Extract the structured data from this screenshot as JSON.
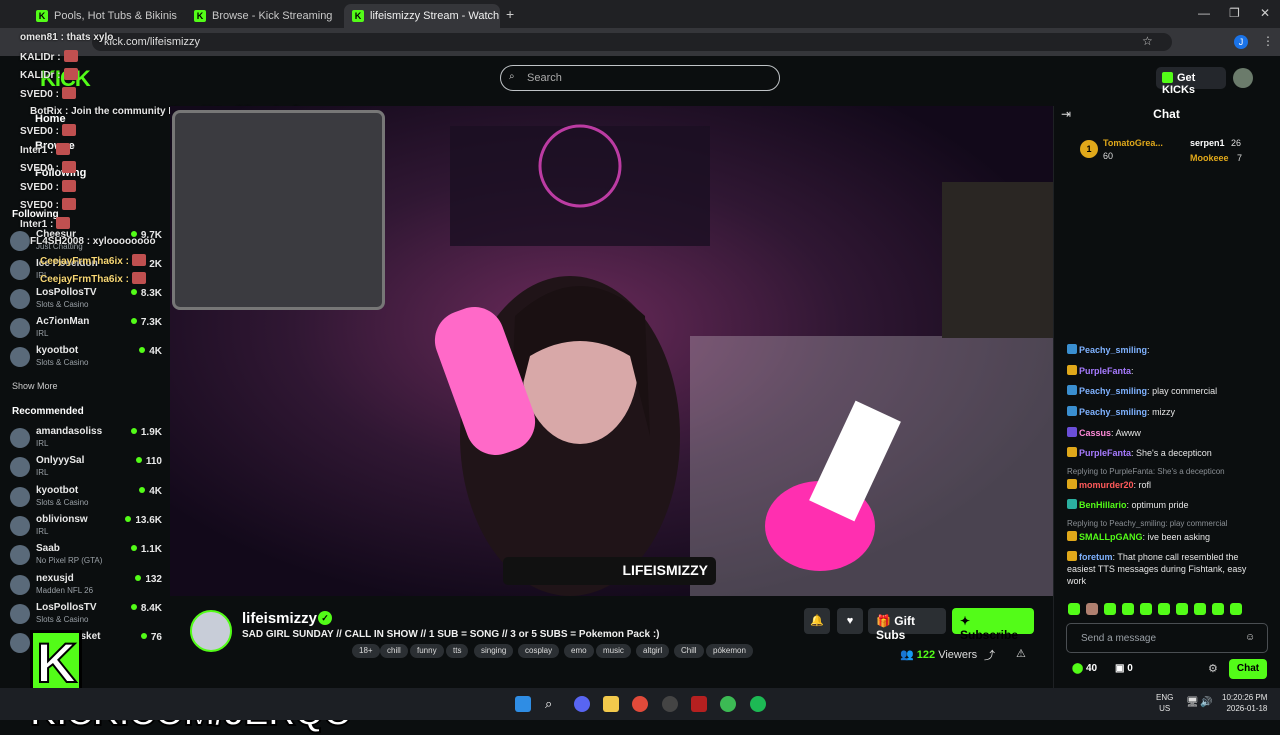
{
  "browser": {
    "tabs": [
      {
        "title": "Pools, Hot Tubs & Bikinis Strea"
      },
      {
        "title": "Browse - Kick Streaming"
      },
      {
        "title": "lifeismizzy Stream - Watch"
      }
    ],
    "url": "kick.com/lifeismizzy"
  },
  "header": {
    "search_placeholder": "Search",
    "get_kicks": "Get KICKs",
    "logo": "KICK"
  },
  "sidebar": {
    "home": "Home",
    "browse": "Browse",
    "following": "Following",
    "following_section": "Following",
    "show_more": "Show More",
    "recommended": "Recommended",
    "following_list": [
      {
        "name": "Cheesur",
        "category": "Just Chatting",
        "viewers": "9.7K"
      },
      {
        "name": "Ice Poseidon",
        "category": "IRL",
        "viewers": "2K"
      },
      {
        "name": "LosPollosTV",
        "category": "Slots & Casino",
        "viewers": "8.3K"
      },
      {
        "name": "Ac7ionMan",
        "category": "IRL",
        "viewers": "7.3K"
      },
      {
        "name": "kyootbot",
        "category": "Slots & Casino",
        "viewers": "4K"
      }
    ],
    "recommended_list": [
      {
        "name": "amandasoliss",
        "category": "IRL",
        "viewers": "1.9K"
      },
      {
        "name": "OnlyyySal",
        "category": "IRL",
        "viewers": "110"
      },
      {
        "name": "kyootbot",
        "category": "Slots & Casino",
        "viewers": "4K"
      },
      {
        "name": "oblivionsw",
        "category": "IRL",
        "viewers": "13.6K"
      },
      {
        "name": "Saab",
        "category": "No Pixel RP (GTA)",
        "viewers": "1.1K"
      },
      {
        "name": "nexusjd",
        "category": "Madden NFL 26",
        "viewers": "132"
      },
      {
        "name": "LosPollosTV",
        "category": "Slots & Casino",
        "viewers": "8.4K"
      },
      {
        "name": "elroiokbasket",
        "category": "",
        "viewers": "76"
      }
    ]
  },
  "overlay_chat": [
    {
      "text": "omen81 : thats xylo"
    },
    {
      "text": "KALIDr :"
    },
    {
      "text": "KALIDr :"
    },
    {
      "text": "SVED0 :"
    },
    {
      "text": "BotRix : Join the community Discord https://discord.gg/jerqo"
    },
    {
      "text": "SVED0 :"
    },
    {
      "text": "Inter1 :"
    },
    {
      "text": "SVED0 :"
    },
    {
      "text": "SVED0 :"
    },
    {
      "text": "SVED0 :"
    },
    {
      "text": "Inter1 :"
    },
    {
      "text": "FL4SH2008 : xyloooooooo"
    },
    {
      "text": "CeejayFrmTha6ix :"
    },
    {
      "text": "CeejayFrmTha6ix :"
    }
  ],
  "watermark": "KICK.COM/JERQO",
  "stream": {
    "channel": "lifeismizzy",
    "title": "SAD GIRL SUNDAY // CALL IN SHOW // 1 SUB = SONG // 3 or 5 SUBS = Pokemon Pack :)",
    "tags": [
      "18+",
      "chill",
      "funny",
      "tts",
      "singing",
      "cosplay",
      "emo",
      "music",
      "altgirl",
      "Chill",
      "pókemon"
    ],
    "viewers": "122",
    "viewers_label": "Viewers",
    "gift_subs": "Gift Subs",
    "subscribe": "Subscribe"
  },
  "chat": {
    "header": "Chat",
    "leaderboard": [
      {
        "rank": "1",
        "name": "TomatoGrea...",
        "value": "60"
      },
      {
        "name": "serpen1",
        "value": "26"
      },
      {
        "name": "Mookeee",
        "value": "7"
      }
    ],
    "messages": [
      {
        "user": "Peachy_smiling",
        "text": "",
        "color": "#7fb2ff"
      },
      {
        "user": "PurpleFanta",
        "text": "",
        "color": "#a77bff"
      },
      {
        "user": "Peachy_smiling",
        "text": "play commercial",
        "color": "#7fb2ff"
      },
      {
        "user": "Peachy_smiling",
        "text": "mizzy",
        "color": "#7fb2ff"
      },
      {
        "user": "Cassus",
        "text": "Awww",
        "color": "#ff8ad8"
      },
      {
        "user": "PurpleFanta",
        "text": "She's a decepticon",
        "color": "#a77bff"
      },
      {
        "reply": "Replying to PurpleFanta: She's a decepticon"
      },
      {
        "user": "momurder20",
        "text": "rofl",
        "color": "#ff5a5a"
      },
      {
        "user": "BenHillario",
        "text": "optimum pride",
        "color": "#53fc18"
      },
      {
        "reply": "Replying to Peachy_smiling: play commercial"
      },
      {
        "user": "SMALLpGANG",
        "text": "ive been asking",
        "color": "#53fc18"
      },
      {
        "user": "foretum",
        "text": "That phone call resembled the easiest TTS messages during Fishtank, easy work",
        "color": "#7fb2ff"
      }
    ],
    "input_placeholder": "Send a message",
    "points": "40",
    "second_count": "0",
    "send": "Chat"
  },
  "taskbar": {
    "lang": "ENG",
    "region": "US",
    "time": "10:20:26 PM",
    "date": "2026-01-18"
  },
  "colors": {
    "kick_green": "#53fc18",
    "background": "#0b0e0f"
  }
}
